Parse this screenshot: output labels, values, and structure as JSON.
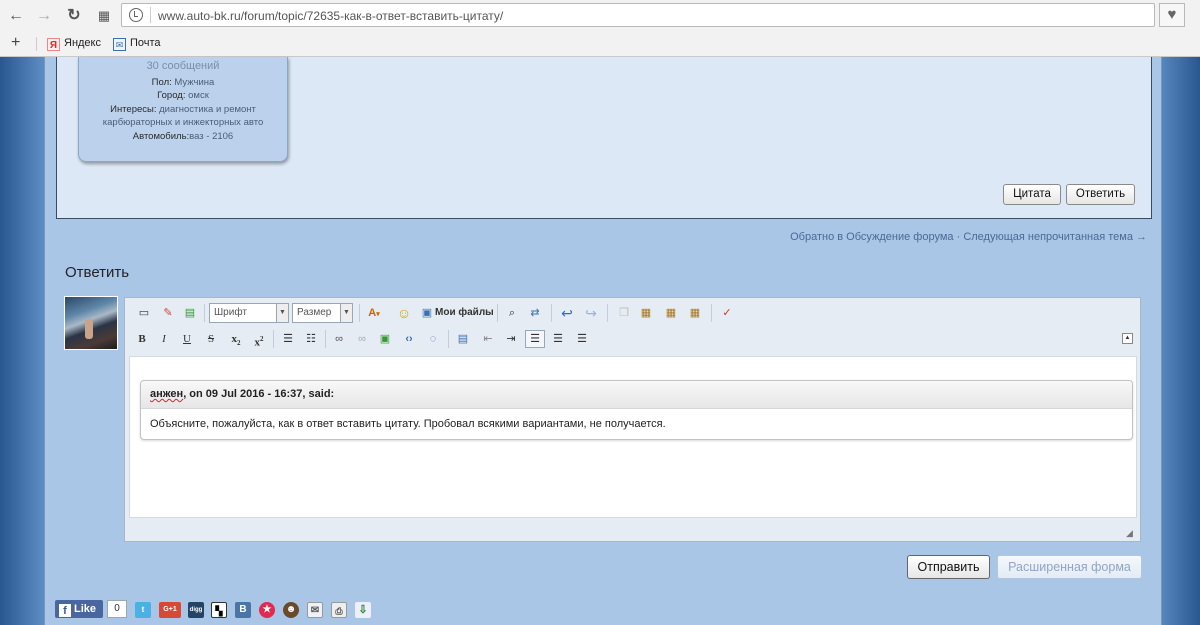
{
  "browser": {
    "url": "www.auto-bk.ru/forum/topic/72635-как-в-ответ-вставить-цитату/",
    "bookmarks": [
      {
        "label": "Яндекс",
        "icon": "yandex-icon"
      },
      {
        "label": "Почта",
        "icon": "mail-icon"
      }
    ]
  },
  "profile": {
    "posts": "30 сообщений",
    "gender_label": "Пол:",
    "gender": "Мужчина",
    "city_label": "Город:",
    "city": "омск",
    "interests_label": "Интересы:",
    "interests": "диагностика и ремонт карбюраторных и инжекторных авто",
    "car_label": "Автомобиль:",
    "car": "ваз - 2106"
  },
  "post_actions": {
    "quote": "Цитата",
    "reply": "Ответить"
  },
  "nav": {
    "back": "Обратно в Обсуждение форума",
    "separator": "·",
    "next": "Следующая непрочитанная тема →"
  },
  "reply": {
    "title": "Ответить",
    "font_select": "Шрифт",
    "size_select": "Размер",
    "my_files": "Мои файлы",
    "quote_author": "анжен",
    "quote_meta": ", on 09 Jul 2016 - 16:37, said:",
    "quote_text": "Объясните, пожалуйста, как в ответ вставить цитату. Пробовал всякими вариантами, не получается.",
    "submit": "Отправить",
    "advanced": "Расширенная форма"
  },
  "social": {
    "like": "Like",
    "like_count": "0",
    "gplus": "G+1",
    "digg": "digg"
  }
}
